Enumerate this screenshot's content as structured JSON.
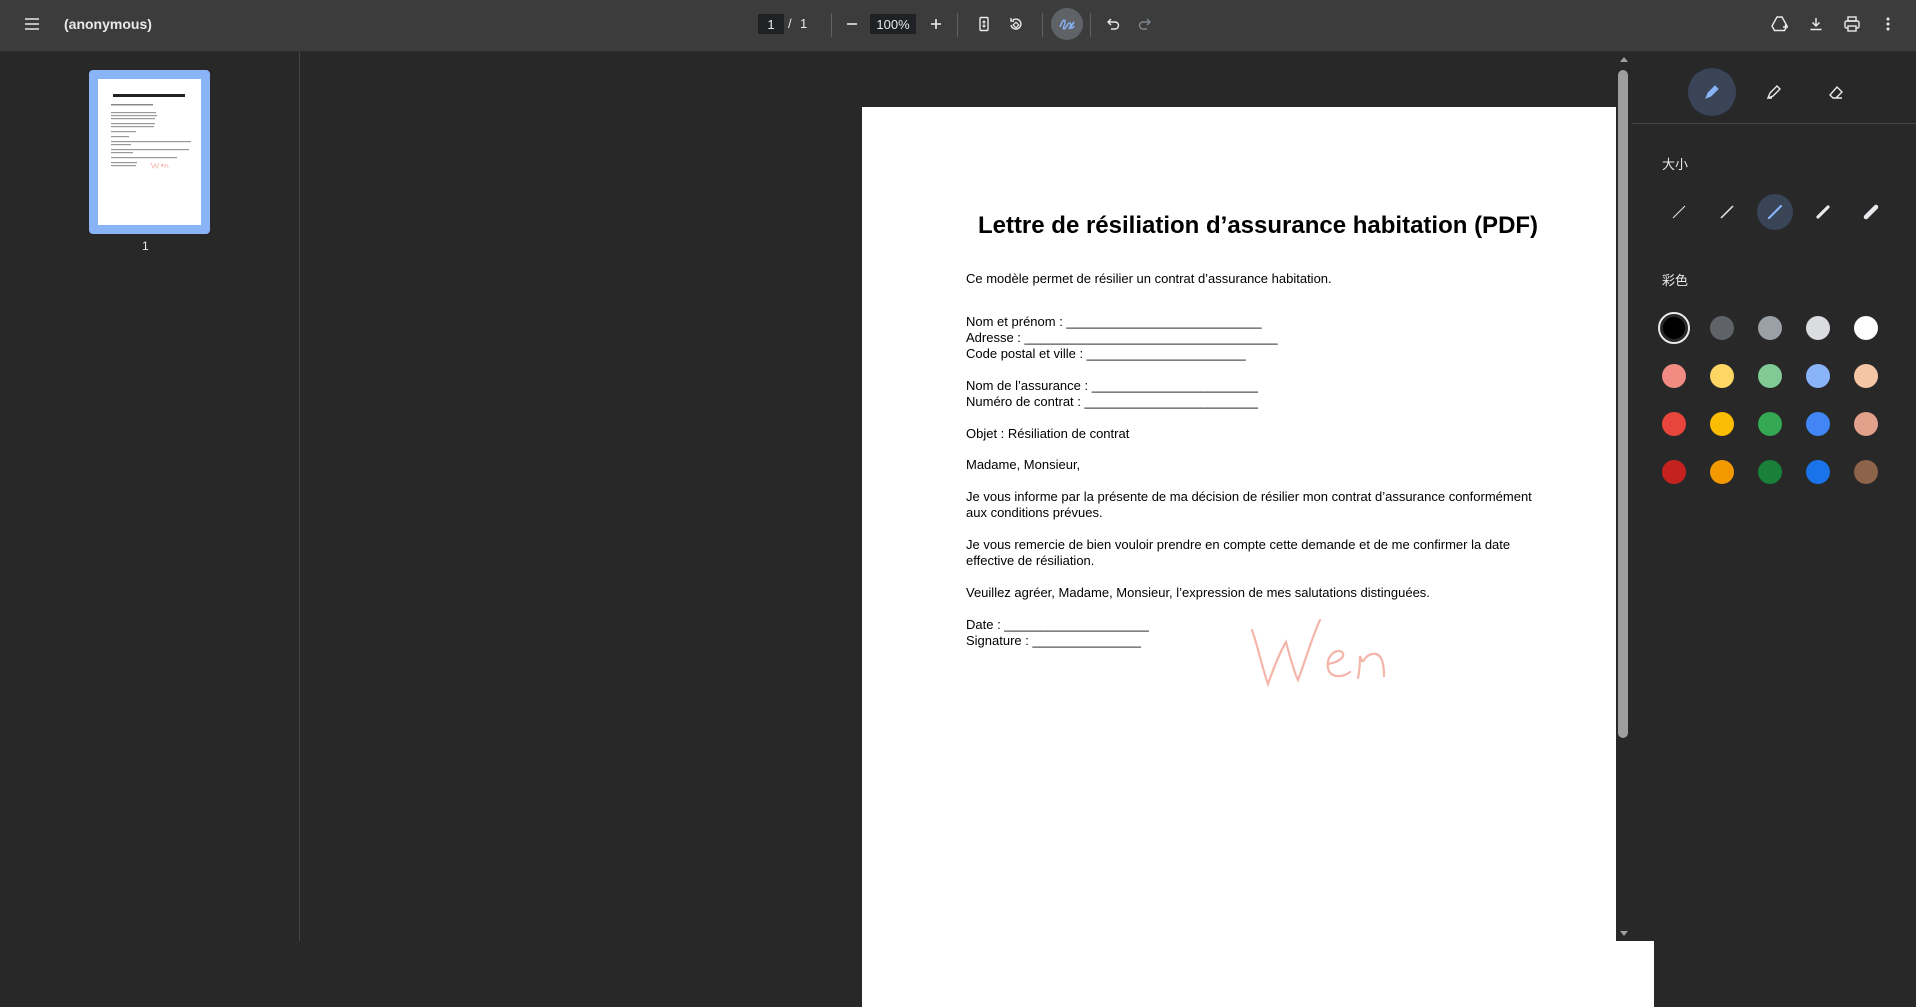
{
  "toolbar": {
    "title": "(anonymous)",
    "page_current": "1",
    "page_separator": "/",
    "page_total": "1",
    "zoom": "100%"
  },
  "sidebar": {
    "thumb_label": "1"
  },
  "document": {
    "title": "Lettre de résiliation d’assurance habitation (PDF)",
    "intro": "Ce modèle permet de résilier un contrat d’assurance habitation.",
    "lines": [
      "Nom et prénom : ___________________________",
      "Adresse : ___________________________________",
      "Code postal et ville : ______________________",
      "Nom de l’assurance : _______________________",
      "Numéro de contrat : ________________________",
      "Objet : Résiliation de contrat",
      "Madame, Monsieur,",
      "Je vous informe par la présente de ma décision de résilier mon contrat d’assurance conformément",
      "aux conditions prévues.",
      "Je vous remercie de bien vouloir prendre en compte cette demande et de me confirmer la date",
      "effective de résiliation.",
      "Veuillez agréer, Madame, Monsieur, l’expression de mes salutations distinguées.",
      "Date : ____________________",
      "Signature : _______________"
    ],
    "signature_text": "Wen"
  },
  "panel": {
    "size_label": "大小",
    "color_label": "彩色",
    "colors": [
      "#000000",
      "#5f6368",
      "#9aa0a6",
      "#dadce0",
      "#ffffff",
      "#f28b82",
      "#fdd663",
      "#81c995",
      "#8ab4f8",
      "#f5c6a5",
      "#e8453c",
      "#fbbc04",
      "#34a853",
      "#4285f4",
      "#e1a18b",
      "#c5221f",
      "#f29900",
      "#188038",
      "#1a73e8",
      "#8d6349"
    ]
  }
}
